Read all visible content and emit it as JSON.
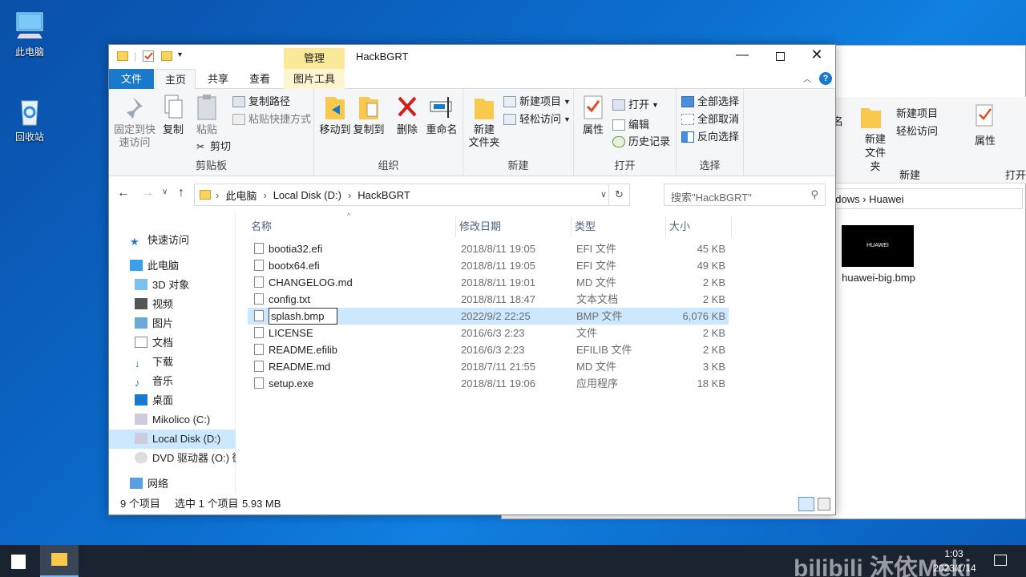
{
  "desktop": {
    "icons": [
      {
        "label": "此电脑"
      },
      {
        "label": "回收站"
      }
    ]
  },
  "bg_window": {
    "ribbon": {
      "new_item": "新建项目",
      "easy_access": "轻松访问",
      "new_folder": "新建\n文件夹",
      "group_new": "新建",
      "properties": "属性",
      "group_open": "打开",
      "cut_partial": "名"
    },
    "address": "ndows  ›  Huawei",
    "file": {
      "name": "huawei-big.bmp",
      "thumb_text": "HUAWEI"
    }
  },
  "window": {
    "title": "HackBGRT",
    "manage_tab": "管理",
    "tabs": [
      "文件",
      "主页",
      "共享",
      "查看",
      "图片工具"
    ],
    "ribbon": {
      "clipboard": {
        "label": "剪贴板",
        "pin": "固定到快\n速访问",
        "copy": "复制",
        "paste": "粘贴",
        "copy_path": "复制路径",
        "paste_shortcut": "粘贴快捷方式",
        "cut": "剪切"
      },
      "organize": {
        "label": "组织",
        "move_to": "移动到",
        "copy_to": "复制到",
        "delete": "删除",
        "rename": "重命名"
      },
      "new": {
        "label": "新建",
        "new_folder": "新建\n文件夹",
        "new_item": "新建项目",
        "easy_access": "轻松访问"
      },
      "open": {
        "label": "打开",
        "properties": "属性",
        "open": "打开",
        "edit": "编辑",
        "history": "历史记录"
      },
      "select": {
        "label": "选择",
        "select_all": "全部选择",
        "select_none": "全部取消",
        "invert": "反向选择"
      }
    },
    "address": {
      "parts": [
        "此电脑",
        "Local Disk (D:)",
        "HackBGRT"
      ],
      "search_placeholder": "搜索\"HackBGRT\""
    },
    "nav": [
      {
        "label": "快速访问"
      },
      {
        "label": "此电脑"
      },
      {
        "label": "3D 对象"
      },
      {
        "label": "视频"
      },
      {
        "label": "图片"
      },
      {
        "label": "文档"
      },
      {
        "label": "下载"
      },
      {
        "label": "音乐"
      },
      {
        "label": "桌面"
      },
      {
        "label": "Mikolico (C:)"
      },
      {
        "label": "Local Disk (D:)"
      },
      {
        "label": "DVD 驱动器 (O:) 微"
      },
      {
        "label": "网络"
      }
    ],
    "columns": [
      "名称",
      "修改日期",
      "类型",
      "大小"
    ],
    "files": [
      {
        "name": "bootia32.efi",
        "date": "2018/8/11 19:05",
        "type": "EFI 文件",
        "size": "45 KB"
      },
      {
        "name": "bootx64.efi",
        "date": "2018/8/11 19:05",
        "type": "EFI 文件",
        "size": "49 KB"
      },
      {
        "name": "CHANGELOG.md",
        "date": "2018/8/11 19:01",
        "type": "MD 文件",
        "size": "2 KB"
      },
      {
        "name": "config.txt",
        "date": "2018/8/11 18:47",
        "type": "文本文档",
        "size": "2 KB"
      },
      {
        "name": "splash.bmp",
        "date": "2022/9/2 22:25",
        "type": "BMP 文件",
        "size": "6,076 KB"
      },
      {
        "name": "LICENSE",
        "date": "2016/6/3 2:23",
        "type": "文件",
        "size": "2 KB"
      },
      {
        "name": "README.efilib",
        "date": "2016/6/3 2:23",
        "type": "EFILIB 文件",
        "size": "2 KB"
      },
      {
        "name": "README.md",
        "date": "2018/7/11 21:55",
        "type": "MD 文件",
        "size": "3 KB"
      },
      {
        "name": "setup.exe",
        "date": "2018/8/11 19:06",
        "type": "应用程序",
        "size": "18 KB"
      }
    ],
    "status": {
      "count": "9 个项目",
      "selected": "选中 1 个项目",
      "size": "5.93 MB"
    }
  },
  "taskbar": {
    "time": "1:03",
    "date": "2023/1/14",
    "watermark": "bilibili 沐依Meki"
  },
  "colors": {
    "accent": "#1979ca",
    "selection": "#cce8ff",
    "manage_tab": "#fbe99a"
  }
}
